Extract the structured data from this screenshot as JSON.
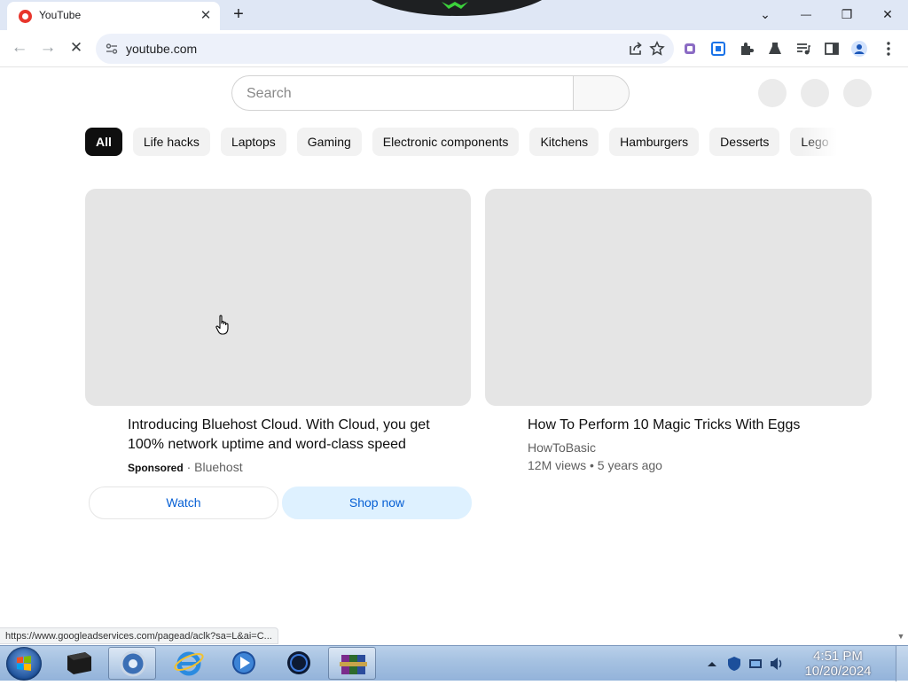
{
  "browser": {
    "tab": {
      "title": "YouTube",
      "close": "✕"
    },
    "new_tab": "+",
    "window_controls": {
      "list": "⌄",
      "minimize": "—",
      "restore": "❐",
      "close": "✕"
    },
    "back": "←",
    "forward": "→",
    "reload": "✕",
    "url": "youtube.com"
  },
  "youtube": {
    "search": {
      "placeholder": "Search"
    },
    "chips": [
      "All",
      "Life hacks",
      "Laptops",
      "Gaming",
      "Electronic components",
      "Kitchens",
      "Hamburgers",
      "Desserts",
      "Lego"
    ],
    "videos": [
      {
        "title_line1": "Introducing Bluehost Cloud. With Cloud, you get",
        "title_line2": "100% network uptime and word-class speed",
        "sponsored": "Sponsored",
        "separator": "·",
        "advertiser": "Bluehost",
        "watch_label": "Watch",
        "shop_label": "Shop now"
      },
      {
        "title": "How To Perform 10 Magic Tricks With Eggs",
        "channel": "HowToBasic",
        "stats": "12M views • 5 years ago"
      }
    ]
  },
  "status_bar": {
    "url": "https://www.googleadservices.com/pagead/aclk?sa=L&ai=C..."
  },
  "taskbar": {
    "clock_time": "4:51 PM",
    "clock_date": "10/20/2024"
  },
  "colors": {
    "chrome_frame": "#dfe7f5",
    "yt_chip_active": "#0f0f0f",
    "yt_link_blue": "#065fd4",
    "taskbar": "#a5c1e1"
  }
}
